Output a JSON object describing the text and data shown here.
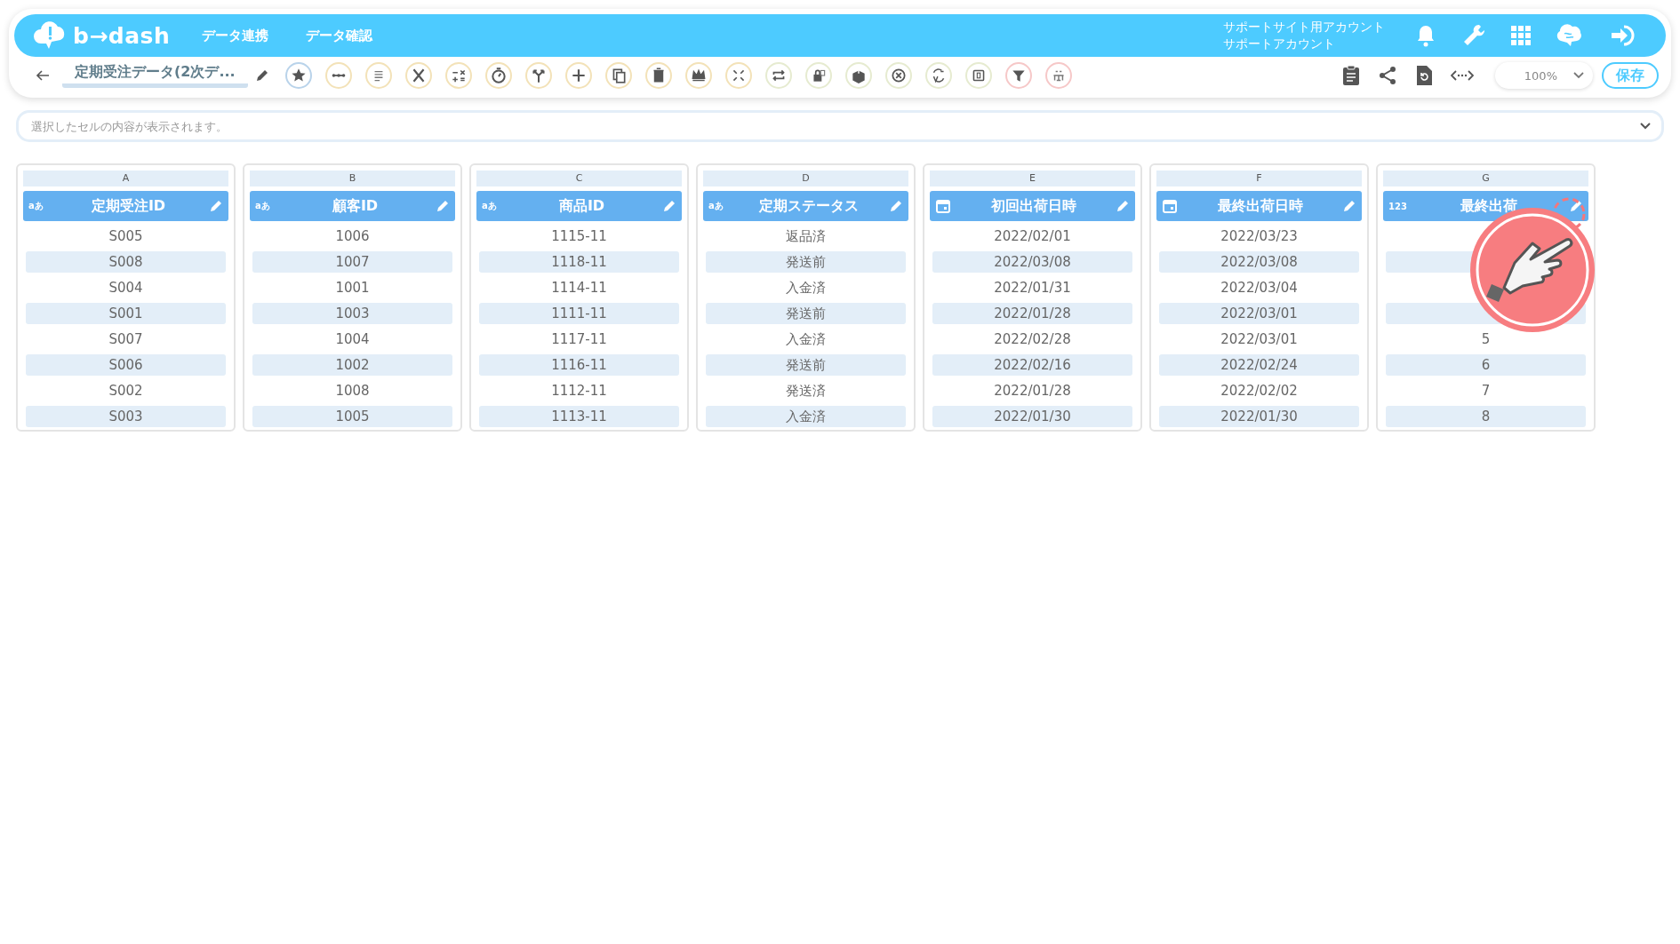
{
  "header": {
    "brand": "b→dash",
    "nav": [
      {
        "label": "データ連携"
      },
      {
        "label": "データ確認"
      }
    ],
    "account": {
      "line_1": "サポートサイト用アカウント",
      "line_2": "サポートアカウント"
    }
  },
  "toolbar": {
    "title": "定期受注データ(2次デ...",
    "zoom": "100%",
    "save": "保存"
  },
  "formula_bar": {
    "placeholder": "選択したセルの内容が表示されます。"
  },
  "columns": [
    {
      "letter": "A",
      "name": "定期受注ID",
      "kind": "text",
      "type_badge": "aあ",
      "cells": [
        "S005",
        "S008",
        "S004",
        "S001",
        "S007",
        "S006",
        "S002",
        "S003"
      ]
    },
    {
      "letter": "B",
      "name": "顧客ID",
      "kind": "text",
      "type_badge": "aあ",
      "cells": [
        "1006",
        "1007",
        "1001",
        "1003",
        "1004",
        "1002",
        "1008",
        "1005"
      ]
    },
    {
      "letter": "C",
      "name": "商品ID",
      "kind": "text",
      "type_badge": "aあ",
      "cells": [
        "1115-11",
        "1118-11",
        "1114-11",
        "1111-11",
        "1117-11",
        "1116-11",
        "1112-11",
        "1113-11"
      ]
    },
    {
      "letter": "D",
      "name": "定期ステータス",
      "kind": "text",
      "type_badge": "aあ",
      "cells": [
        "返品済",
        "発送前",
        "入金済",
        "発送前",
        "入金済",
        "発送前",
        "発送済",
        "入金済"
      ]
    },
    {
      "letter": "E",
      "name": "初回出荷日時",
      "kind": "date",
      "cells": [
        "2022/02/01",
        "2022/03/08",
        "2022/01/31",
        "2022/01/28",
        "2022/02/28",
        "2022/02/16",
        "2022/01/28",
        "2022/01/30"
      ]
    },
    {
      "letter": "F",
      "name": "最終出荷日時",
      "kind": "date",
      "cells": [
        "2022/03/23",
        "2022/03/08",
        "2022/03/04",
        "2022/03/01",
        "2022/03/01",
        "2022/02/24",
        "2022/02/02",
        "2022/01/30"
      ]
    },
    {
      "letter": "G",
      "name": "最終出荷",
      "kind": "number",
      "type_badge": "123",
      "pointer": true,
      "cells": [
        null,
        null,
        null,
        null,
        "5",
        "6",
        "7",
        "8"
      ]
    }
  ]
}
